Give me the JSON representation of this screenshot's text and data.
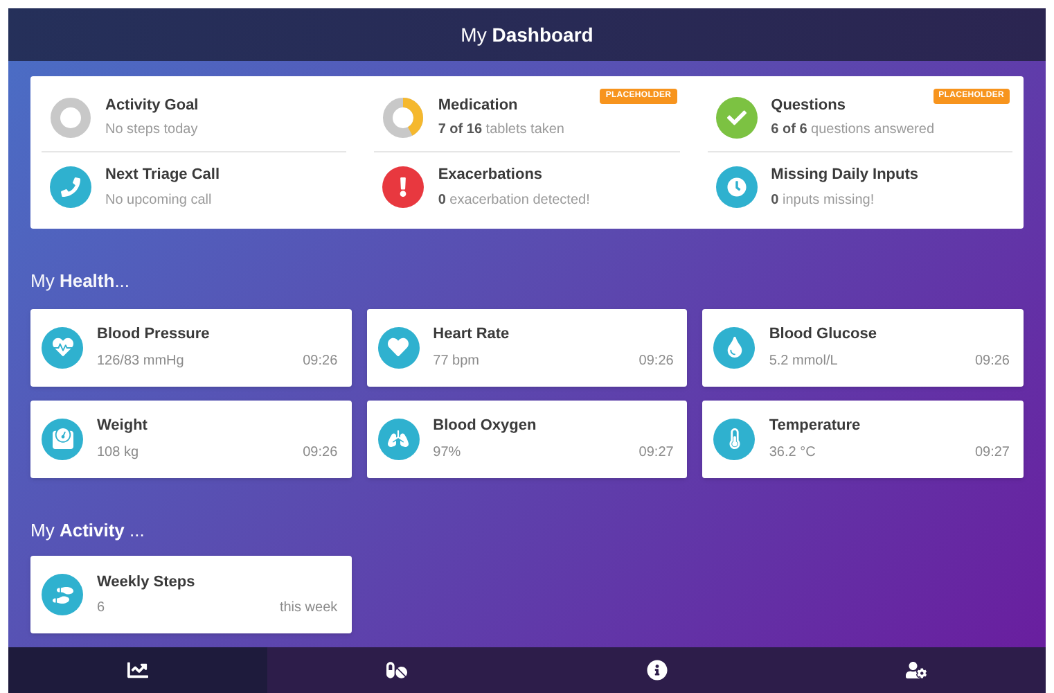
{
  "header": {
    "title": "My **Dashboard**"
  },
  "summary": {
    "items": [
      {
        "kind": "ring",
        "title": "Activity Goal",
        "subtitle": "No steps today"
      },
      {
        "kind": "ring",
        "title": "Medication",
        "subtitle": "**7 of 16** tablets taken",
        "level": 0.42,
        "badge": "PLACEHOLDER"
      },
      {
        "kind": "check",
        "title": "Questions",
        "subtitle": "**6 of 6** questions answered",
        "badge": "PLACEHOLDER"
      },
      {
        "kind": "call",
        "title": "Next Triage Call",
        "subtitle": "No upcoming call"
      },
      {
        "kind": "alert",
        "title": "Exacerbations",
        "subtitle": "**0** exacerbation detected!"
      },
      {
        "kind": "clock",
        "title": "Missing Daily Inputs",
        "subtitle": "**0** inputs missing!"
      }
    ]
  },
  "health": {
    "heading": "My **Health**...",
    "cards": [
      {
        "kind": "blood-pressure",
        "title": "Blood Pressure",
        "value": "126/83 mmHg",
        "time": "09:26"
      },
      {
        "kind": "heart-rate",
        "title": "Heart Rate",
        "value": "77 bpm",
        "time": "09:26"
      },
      {
        "kind": "glucose",
        "title": "Blood Glucose",
        "value": "5.2 mmol/L",
        "time": "09:26"
      },
      {
        "kind": "weight",
        "title": "Weight",
        "value": "108 kg",
        "time": "09:26"
      },
      {
        "kind": "oxygen",
        "title": "Blood Oxygen",
        "value": "97%",
        "time": "09:27"
      },
      {
        "kind": "temperature",
        "title": "Temperature",
        "value": "36.2 °C",
        "time": "09:27"
      }
    ]
  },
  "activity": {
    "heading": "My **Activity** ...",
    "cards": [
      {
        "kind": "steps",
        "title": "Weekly Steps",
        "value": "6",
        "time": "this week"
      }
    ]
  },
  "nav": {
    "tabs": [
      {
        "kind": "chart",
        "selected": true
      },
      {
        "kind": "pills",
        "selected": false
      },
      {
        "kind": "info",
        "selected": false
      },
      {
        "kind": "user-settings",
        "selected": false
      }
    ]
  }
}
